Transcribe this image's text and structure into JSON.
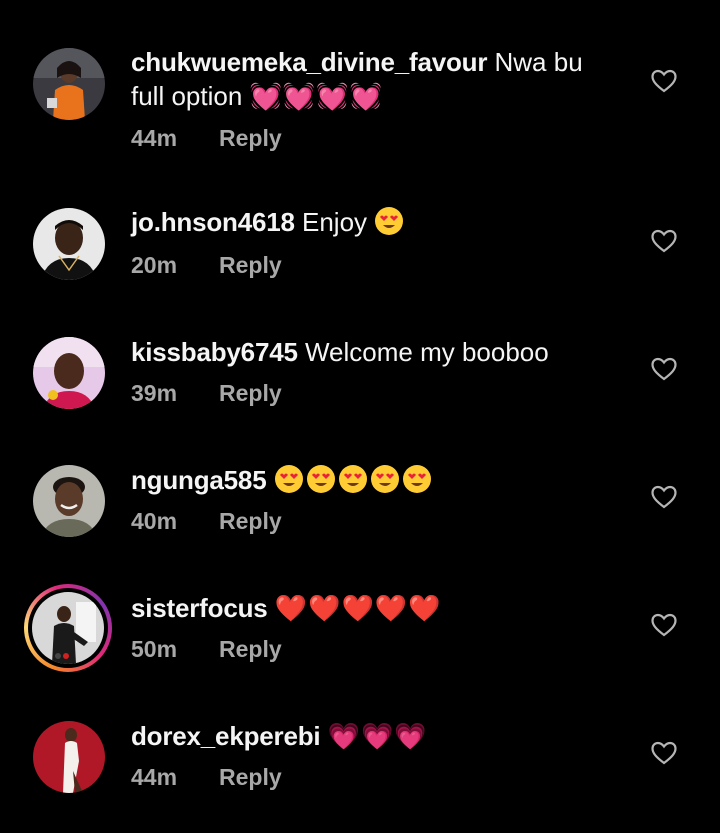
{
  "comments": [
    {
      "username": "chukwuemeka_divine_favour",
      "text": "Nwa bu full option",
      "reaction": "💓💓💓💓",
      "time": "44m",
      "reply_label": "Reply",
      "avatar_icon": "profile-photo-woman-orange-outfit",
      "story_ring": false
    },
    {
      "username": "jo.hnson4618",
      "text": "Enjoy",
      "reaction": "😍",
      "time": "20m",
      "reply_label": "Reply",
      "avatar_icon": "profile-photo-man",
      "story_ring": false
    },
    {
      "username": "kissbaby6745",
      "text": "Welcome my booboo",
      "reaction": "",
      "time": "39m",
      "reply_label": "Reply",
      "avatar_icon": "profile-photo-woman-pink",
      "story_ring": false
    },
    {
      "username": "ngunga585",
      "text": "",
      "reaction": "😍😍😍😍😍",
      "time": "40m",
      "reply_label": "Reply",
      "avatar_icon": "profile-photo-woman",
      "story_ring": false
    },
    {
      "username": "sisterfocus",
      "text": "",
      "reaction": "❤️❤️❤️❤️❤️",
      "time": "50m",
      "reply_label": "Reply",
      "avatar_icon": "profile-photo-man-suit",
      "story_ring": true
    },
    {
      "username": "dorex_ekperebi",
      "text": "",
      "reaction": "💗💗💗",
      "time": "44m",
      "reply_label": "Reply",
      "avatar_icon": "profile-photo-woman-red-background",
      "story_ring": false
    }
  ],
  "colors": {
    "background": "#000000",
    "text": "#f5f5f5",
    "meta": "#a8a8a8",
    "heart_red": "#e8213c",
    "heart_pink": "#ff5c8a",
    "story_ring": "#dd2a7b"
  },
  "like_icon": "heart-outline-icon"
}
